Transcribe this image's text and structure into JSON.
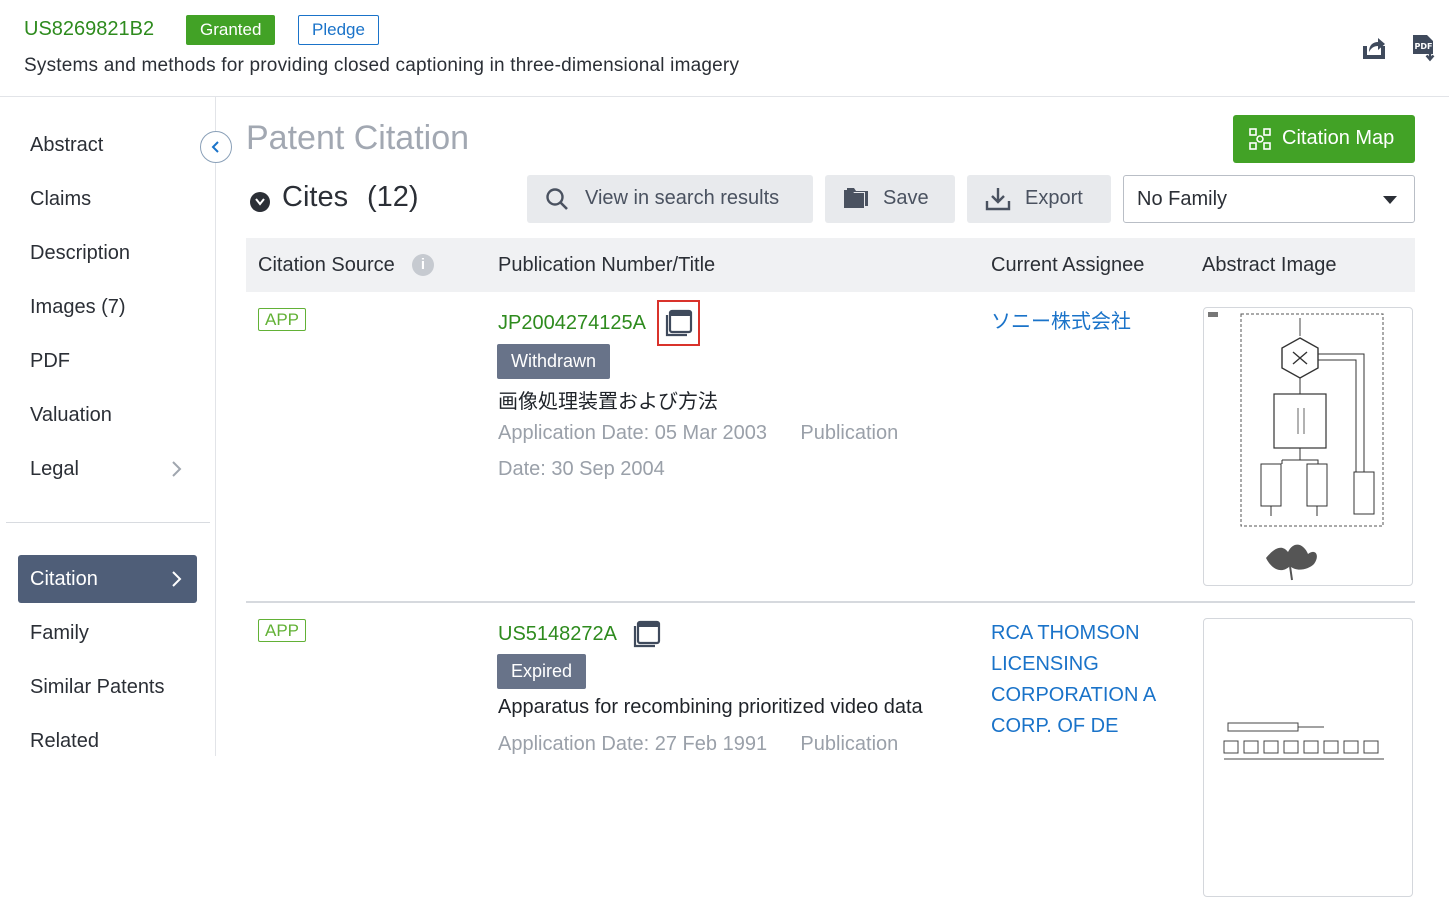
{
  "header": {
    "patent_number": "US8269821B2",
    "status_badge": "Granted",
    "pledge_badge": "Pledge",
    "title": "Systems and methods for providing closed captioning in three-dimensional imagery",
    "icons": [
      "share-icon",
      "pdf-download-icon"
    ]
  },
  "sidebar": {
    "items": [
      {
        "label": "Abstract"
      },
      {
        "label": "Claims"
      },
      {
        "label": "Description"
      },
      {
        "label": "Images (7)"
      },
      {
        "label": "PDF"
      },
      {
        "label": "Valuation"
      },
      {
        "label": "Legal"
      },
      {
        "label": "Citation"
      },
      {
        "label": "Family"
      },
      {
        "label": "Similar Patents"
      },
      {
        "label": "Related"
      }
    ]
  },
  "main": {
    "page_title": "Patent Citation",
    "citation_map_label": "Citation Map",
    "cites_label": "Cites",
    "cites_count": "(12)",
    "view_search_label": "View in search results",
    "save_label": "Save",
    "export_label": "Export",
    "family_select": "No Family",
    "columns": [
      "Citation Source",
      "Publication Number/Title",
      "Current Assignee",
      "Abstract Image"
    ],
    "rows": [
      {
        "source": "APP",
        "pub_number": "JP2004274125A",
        "status": "Withdrawn",
        "title": "画像処理装置および方法",
        "dates_line1": "Application Date: 05 Mar 2003      Publication",
        "dates_line2": "Date: 30 Sep 2004",
        "assignee": "ソニー株式会社"
      },
      {
        "source": "APP",
        "pub_number": "US5148272A",
        "status": "Expired",
        "title": "Apparatus for recombining prioritized video data",
        "dates_line1": "Application Date: 27 Feb 1991      Publication",
        "assignee_lines": [
          "RCA THOMSON",
          "LICENSING",
          "CORPORATION A",
          "CORP. OF DE"
        ]
      }
    ]
  },
  "colors": {
    "brand_green": "#42a226",
    "link_blue": "#1a73c9",
    "nav_active": "#4f5e78",
    "highlight_red": "#d9322b"
  }
}
